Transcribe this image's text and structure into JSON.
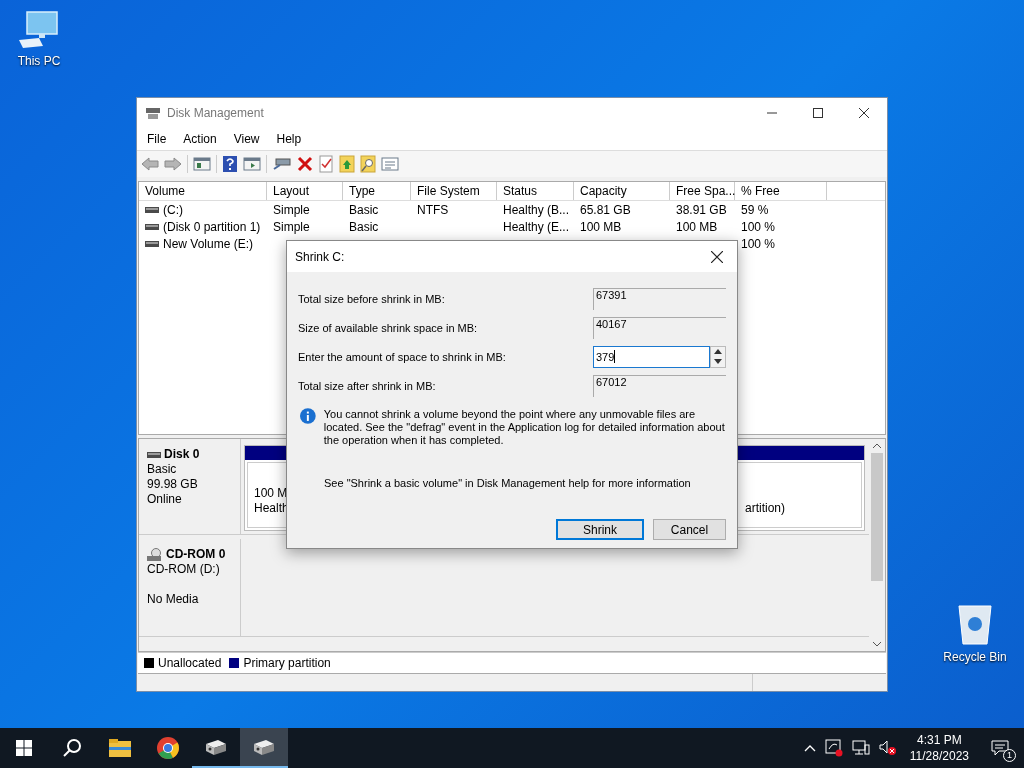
{
  "desktop_icons": [
    {
      "kind": "computer",
      "label": "This PC"
    },
    {
      "kind": "bin",
      "label": "Recycle Bin"
    }
  ],
  "window": {
    "title": "Disk Management"
  },
  "menu": [
    "File",
    "Action",
    "View",
    "Help"
  ],
  "volume_table": {
    "columns": [
      "Volume",
      "Layout",
      "Type",
      "File System",
      "Status",
      "Capacity",
      "Free Spa...",
      "% Free"
    ],
    "rows": [
      {
        "volume": "(C:)",
        "layout": "Simple",
        "type": "Basic",
        "file_system": "NTFS",
        "status": "Healthy (B...",
        "capacity": "65.81 GB",
        "free_space": "38.91 GB",
        "pct_free": "59 %"
      },
      {
        "volume": "(Disk 0 partition 1)",
        "layout": "Simple",
        "type": "Basic",
        "status": "Healthy (E...",
        "capacity": "100 MB",
        "free_space": "100 MB",
        "pct_free": "100 %"
      },
      {
        "volume": "New Volume (E:)",
        "pct_free": "100 %"
      }
    ]
  },
  "disks": [
    {
      "kind": "disk",
      "name": "Disk 0",
      "type": "Basic",
      "size": "99.98 GB",
      "status": "Online",
      "partitions": [
        {
          "kind": "primary",
          "lines": [
            "100 M",
            "Health"
          ]
        },
        {
          "kind": "primary",
          "lines": [
            "artition)"
          ]
        }
      ]
    },
    {
      "kind": "cdrom",
      "name": "CD-ROM 0",
      "type": "CD-ROM (D:)",
      "status": "No Media"
    }
  ],
  "legend": [
    {
      "label": "Unallocated",
      "color": "#000000"
    },
    {
      "label": "Primary partition",
      "color": "#000080"
    }
  ],
  "dialog": {
    "title": "Shrink C:",
    "fields": [
      {
        "kind": "readonly",
        "label": "Total size before shrink in MB:",
        "value": "67391"
      },
      {
        "kind": "readonly",
        "label": "Size of available shrink space in MB:",
        "value": "40167"
      },
      {
        "kind": "spin",
        "label": "Enter the amount of space to shrink in MB:",
        "value": "379"
      },
      {
        "kind": "readonly",
        "label": "Total size after shrink in MB:",
        "value": "67012"
      }
    ],
    "info": "You cannot shrink a volume beyond the point where any unmovable files are located. See the \"defrag\" event in the Application log for detailed information about the operation when it has completed.",
    "help": "See \"Shrink a basic volume\" in Disk Management help for more information",
    "buttons": [
      {
        "label": "Shrink",
        "default": true
      },
      {
        "label": "Cancel",
        "default": false
      }
    ]
  },
  "taskbar": {
    "items": [
      {
        "kind": "start",
        "running": false,
        "selected": false
      },
      {
        "kind": "search",
        "running": false,
        "selected": false
      },
      {
        "kind": "folder",
        "running": false,
        "selected": false
      },
      {
        "kind": "browser",
        "running": false,
        "selected": false
      },
      {
        "kind": "app",
        "running": true,
        "selected": false
      },
      {
        "kind": "app",
        "running": true,
        "selected": true
      }
    ],
    "time": "4:31 PM",
    "date": "11/28/2023",
    "notifications": "1"
  }
}
